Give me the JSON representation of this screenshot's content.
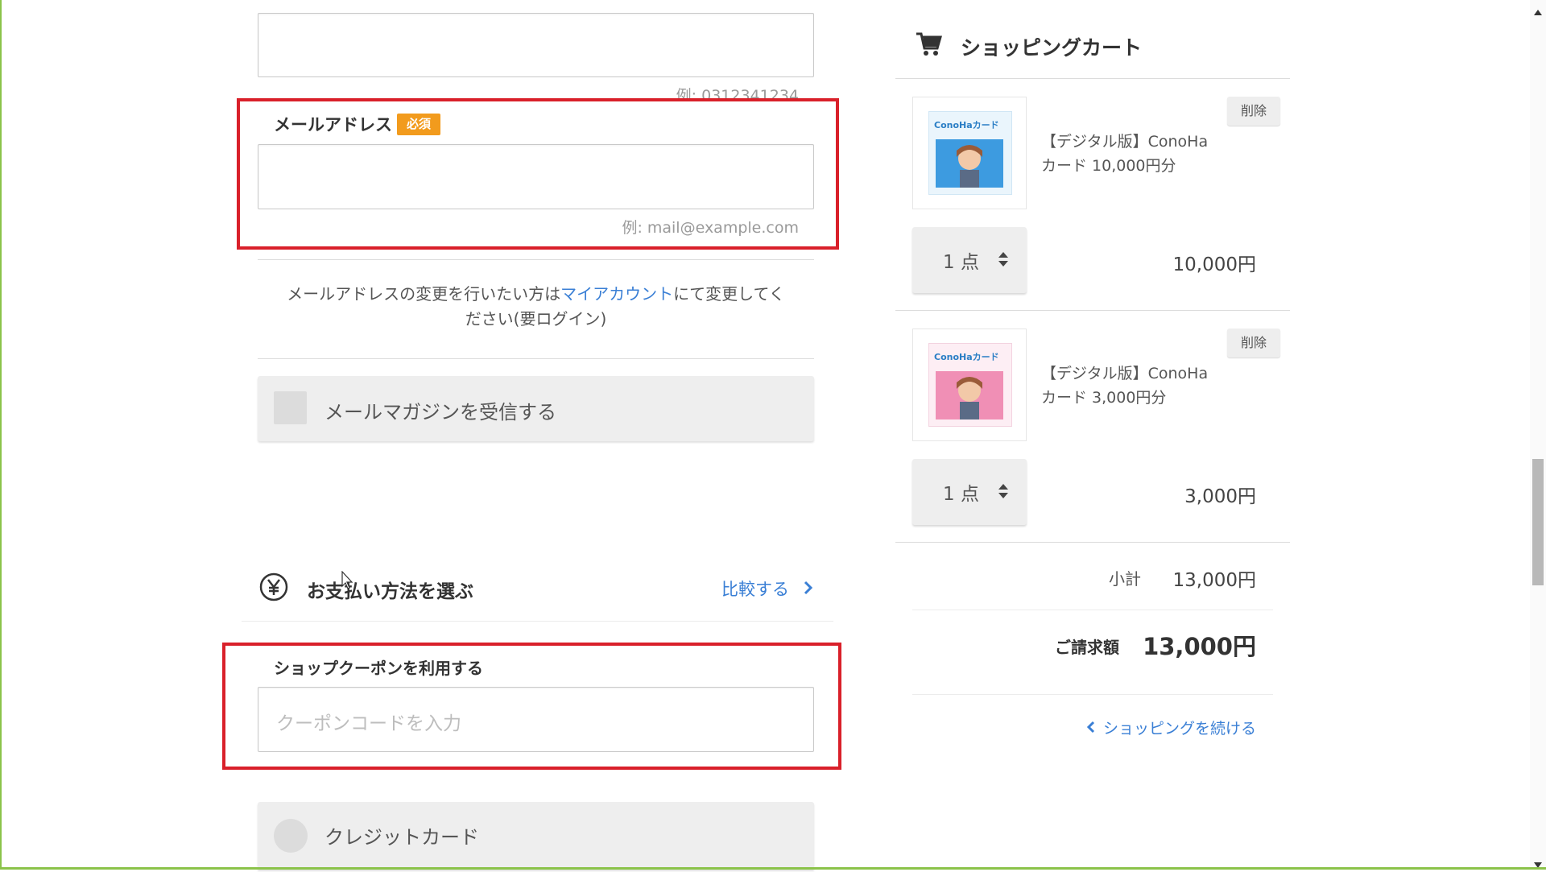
{
  "form": {
    "phone_hint": "例: 0312341234",
    "email_label": "メールアドレス",
    "required_badge": "必須",
    "email_value": "",
    "email_hint": "例: mail@example.com",
    "account_note_before": "メールアドレスの変更を行いたい方は",
    "account_note_link": "マイアカウント",
    "account_note_after_line1": "にて変更してく",
    "account_note_line2": "ださい(要ログイン)",
    "newsletter_label": "メールマガジンを受信する",
    "payment_section_title": "お支払い方法を選ぶ",
    "compare_link": "比較する",
    "coupon_label": "ショップクーポンを利用する",
    "coupon_placeholder": "クーポンコードを入力",
    "credit_card_label": "クレジットカード"
  },
  "cart": {
    "title": "ショッピングカート",
    "items": [
      {
        "name_line1": "【デジタル版】ConoHa",
        "name_line2": "カード 10,000円分",
        "delete_label": "削除",
        "quantity": "1 点",
        "price": "10,000円",
        "thumb_brand": "ConoHaカード",
        "thumb_color": "#3d9be0"
      },
      {
        "name_line1": "【デジタル版】ConoHa",
        "name_line2": "カード 3,000円分",
        "delete_label": "削除",
        "quantity": "1 点",
        "price": "3,000円",
        "thumb_brand": "ConoHaカード",
        "thumb_color": "#f08fb5"
      }
    ],
    "subtotal_label": "小計",
    "subtotal_value": "13,000円",
    "total_label": "ご請求額",
    "total_value": "13,000円",
    "continue_link": "ショッピングを続ける"
  },
  "colors": {
    "highlight_frame": "#d9202a",
    "link": "#3a7fd5",
    "required_badge": "#f29b1d"
  }
}
